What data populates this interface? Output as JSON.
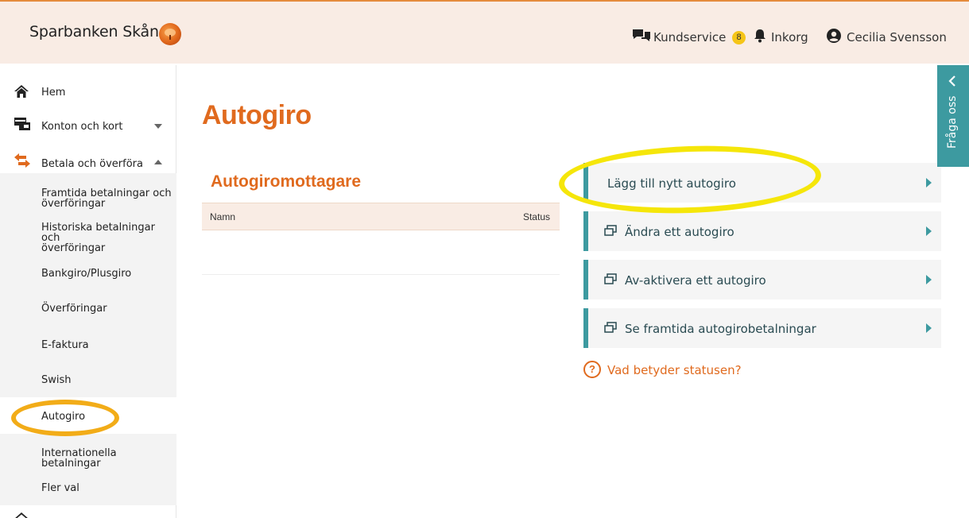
{
  "header": {
    "brand": "Sparbanken Skåne",
    "customer_service": "Kundservice",
    "inbox_count": "8",
    "inbox": "Inkorg",
    "user": "Cecilia Svensson"
  },
  "sidebar": {
    "items": [
      {
        "label": "Hem",
        "icon": "home-icon"
      },
      {
        "label": "Konton och kort",
        "icon": "card-icon"
      },
      {
        "label": "Betala och överföra",
        "icon": "transfer-icon"
      }
    ],
    "submenu": [
      {
        "label": "Framtida betalningar och\növerföringar"
      },
      {
        "label": "Historiska betalningar och\növerföringar"
      },
      {
        "label": "Bankgiro/Plusgiro"
      },
      {
        "label": "Överföringar"
      },
      {
        "label": "E-faktura"
      },
      {
        "label": "Swish"
      },
      {
        "label": "Autogiro",
        "active": true
      },
      {
        "label": "Internationella betalningar"
      },
      {
        "label": "Fler val"
      }
    ]
  },
  "main": {
    "title": "Autogiro",
    "section_title": "Autogiromottagare",
    "table": {
      "columns": [
        "Namn",
        "Status"
      ],
      "rows": []
    },
    "actions": [
      {
        "label": "Lägg till nytt autogiro",
        "icon": ""
      },
      {
        "label": "Ändra ett autogiro",
        "icon": "external-window-icon"
      },
      {
        "label": "Av-aktivera ett autogiro",
        "icon": "external-window-icon"
      },
      {
        "label": "Se framtida autogirobetalningar",
        "icon": "external-window-icon"
      }
    ],
    "help_icon": "?",
    "help_link": "Vad betyder statusen?"
  },
  "side_tab": {
    "label": "Fråga oss"
  },
  "colors": {
    "accent_orange": "#e06a1e",
    "teal": "#3d9aa0",
    "header_bg": "#f9ece4"
  }
}
